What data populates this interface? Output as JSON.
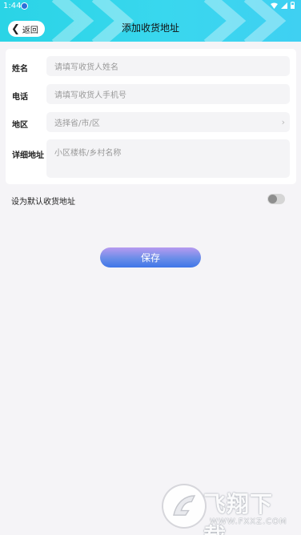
{
  "status_bar": {
    "time": "1:44"
  },
  "header": {
    "back_label": "返回",
    "title": "添加收货地址"
  },
  "form": {
    "name": {
      "label": "姓名",
      "placeholder": "请填写收货人姓名"
    },
    "phone": {
      "label": "电话",
      "placeholder": "请填写收货人手机号"
    },
    "region": {
      "label": "地区",
      "placeholder": "选择省/市/区"
    },
    "address": {
      "label": "详细地址",
      "placeholder": "小区楼栋/乡村名称"
    }
  },
  "default_address": {
    "label": "设为默认收货地址",
    "enabled": false
  },
  "save_label": "保存",
  "watermark": {
    "brand": "飞翔下载",
    "url": "WWW.FXXZ.COM"
  },
  "colors": {
    "header_gradient_start": "#2ad4e6",
    "header_gradient_end": "#3fd0f2",
    "button_start": "#b79af0",
    "button_end": "#3f76e8",
    "page_bg": "#f5f4f7"
  }
}
